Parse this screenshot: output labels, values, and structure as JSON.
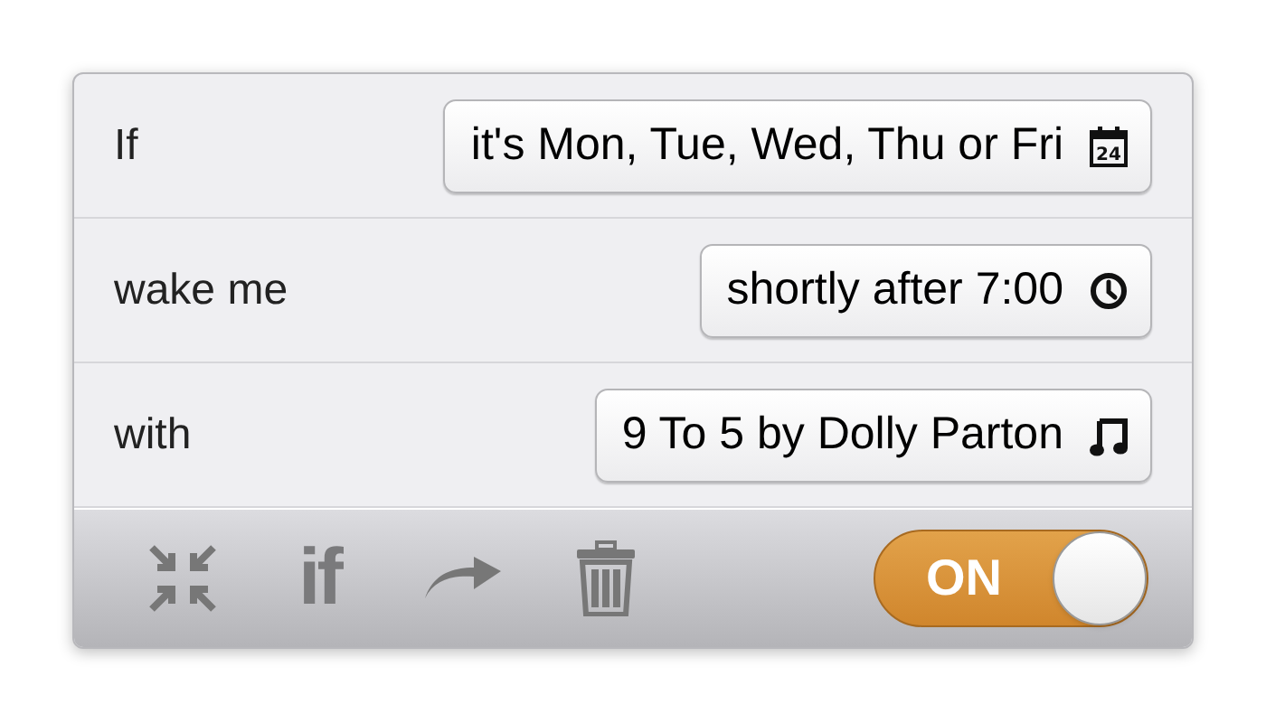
{
  "rows": [
    {
      "label": "If",
      "value": "it's Mon, Tue, Wed, Thu or Fri",
      "kind": "calendar",
      "icon_text": "24"
    },
    {
      "label": "wake me",
      "value": "shortly after 7:00",
      "kind": "clock"
    },
    {
      "label": "with",
      "value": "9 To 5 by Dolly Parton",
      "kind": "music"
    }
  ],
  "toolbar": {
    "if_label": "if",
    "toggle": {
      "label": "ON",
      "on": true
    }
  }
}
